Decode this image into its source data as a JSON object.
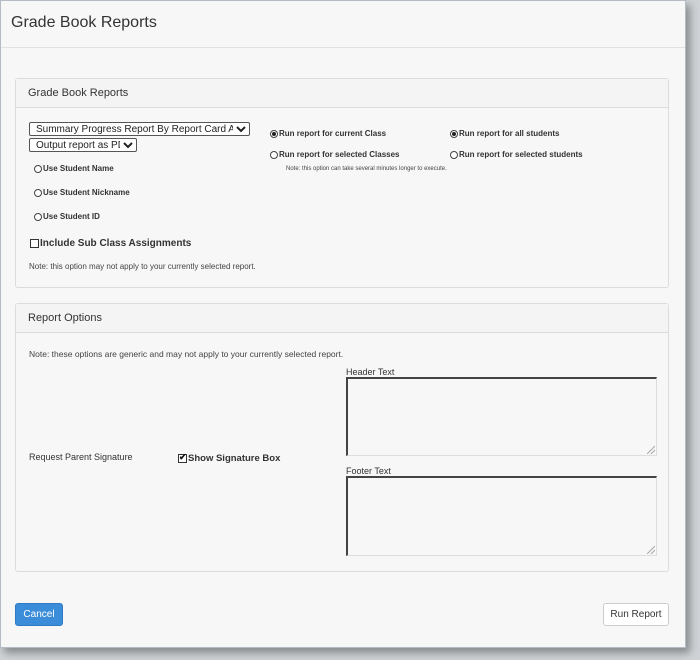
{
  "dialog": {
    "title": "Grade Book Reports"
  },
  "reports_panel": {
    "heading": "Grade Book Reports",
    "report_select": {
      "selected": "Summary Progress Report By Report Card Area"
    },
    "output_select": {
      "selected": "Output report as PDF"
    },
    "name_options": [
      {
        "label": "Use Student Name",
        "checked": false
      },
      {
        "label": "Use Student Nickname",
        "checked": false
      },
      {
        "label": "Use Student ID",
        "checked": false
      }
    ],
    "class_options": [
      {
        "label": "Run report for current Class",
        "checked": true
      },
      {
        "label": "Run report for selected Classes",
        "checked": false
      }
    ],
    "class_note": "Note: this option can take several minutes longer to execute.",
    "student_options": [
      {
        "label": "Run report for all students",
        "checked": true
      },
      {
        "label": "Run report for selected students",
        "checked": false
      }
    ],
    "sub_class": {
      "label": "Include Sub Class Assignments",
      "checked": false
    },
    "note": "Note: this option may not apply to your currently selected report."
  },
  "options_panel": {
    "heading": "Report Options",
    "note": "Note: these options are generic and may not apply to your currently selected report.",
    "parent_signature_label": "Request Parent Signature",
    "signature_box": {
      "label": "Show Signature Box",
      "checked": true
    },
    "header_text": {
      "label": "Header Text",
      "value": ""
    },
    "footer_text": {
      "label": "Footer Text",
      "value": ""
    }
  },
  "footer": {
    "cancel_label": "Cancel",
    "run_label": "Run Report",
    "primary_color": "#3c8dd9"
  }
}
